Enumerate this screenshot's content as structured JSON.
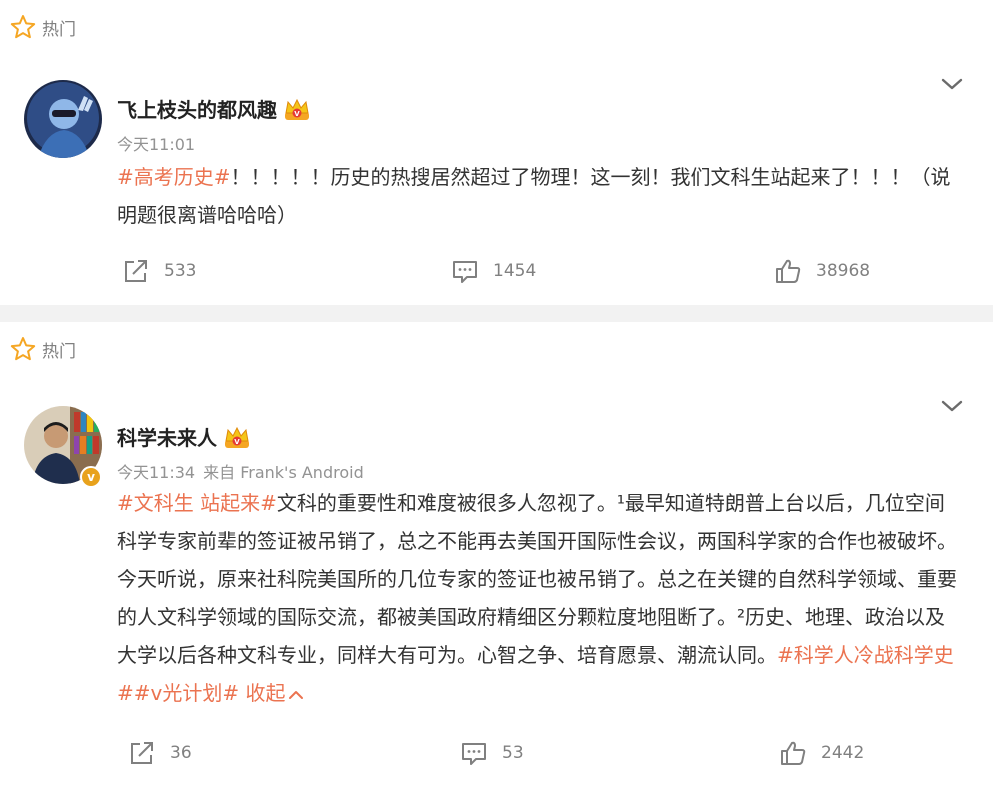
{
  "posts": [
    {
      "hot_label": "热门",
      "username": "飞上枝头的都风趣",
      "time": "今天11:01",
      "source": "",
      "text_parts": [
        {
          "type": "tag",
          "text": "#高考历史#"
        },
        {
          "type": "text",
          "text": "！！！！！历史的热搜居然超过了物理！这一刻！我们文科生站起来了！！！（说明题很离谱哈哈哈）"
        }
      ],
      "share_count": "533",
      "comment_count": "1454",
      "like_count": "38968"
    },
    {
      "hot_label": "热门",
      "username": "科学未来人",
      "time": "今天11:34",
      "source": "来自 Frank's Android",
      "verified_badge": "v",
      "text_parts": [
        {
          "type": "tag",
          "text": "#文科生 站起来#"
        },
        {
          "type": "text",
          "text": "文科的重要性和难度被很多人忽视了。¹最早知道特朗普上台以后，几位空间科学专家前辈的签证被吊销了，总之不能再去美国开国际性会议，两国科学家的合作也被破坏。今天听说，原来社科院美国所的几位专家的签证也被吊销了。总之在关键的自然科学领域、重要的人文科学领域的国际交流，都被美国政府精细区分颗粒度地阻断了。²历史、地理、政治以及大学以后各种文科专业，同样大有可为。心智之争、培育愿景、潮流认同。"
        },
        {
          "type": "tag",
          "text": "#科学人冷战科学史##v光计划#"
        },
        {
          "type": "text",
          "text": " "
        },
        {
          "type": "link",
          "text": "收起"
        }
      ],
      "share_count": "36",
      "comment_count": "53",
      "like_count": "2442"
    }
  ],
  "colors": {
    "accent": "#eb7350",
    "meta": "#939393",
    "icon": "#808080",
    "separator": "#f2f2f2",
    "crown": "#f5a623"
  },
  "icons": {
    "hot": "star-outline-icon",
    "more": "chevron-down-icon",
    "crown": "vip-crown-icon",
    "share": "share-icon",
    "comment": "comment-icon",
    "like": "thumb-up-icon",
    "collapse": "chevron-up-icon"
  }
}
